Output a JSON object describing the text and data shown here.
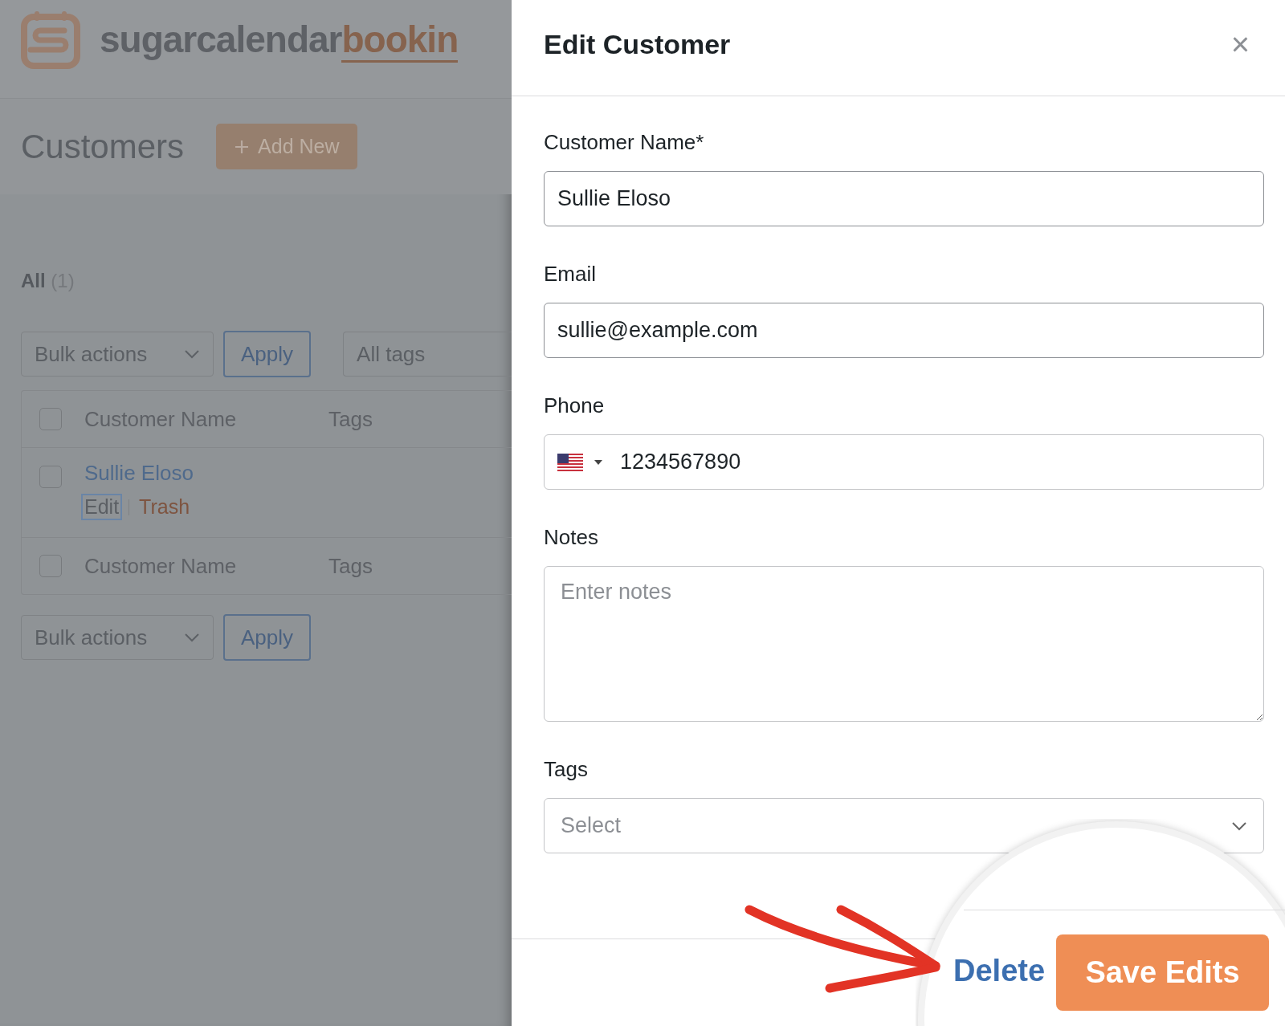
{
  "logo": {
    "main": "sugarcalendar",
    "accent": "bookin"
  },
  "page": {
    "title": "Customers",
    "add_button": "Add New"
  },
  "views": [
    {
      "label": "All",
      "count": "(1)",
      "selected": true
    }
  ],
  "bulk_top": {
    "select": "Bulk actions",
    "apply": "Apply",
    "tag_filter": "All tags"
  },
  "table": {
    "header_checked": false,
    "columns": [
      "Customer Name",
      "Tags"
    ],
    "rows": [
      {
        "name": "Sullie Eloso",
        "checked": false,
        "actions": [
          {
            "label": "Edit",
            "kind": "link",
            "focused": true
          },
          {
            "label": "Trash",
            "kind": "danger",
            "focused": false
          }
        ]
      }
    ],
    "footer_checked": false,
    "footer_columns": [
      "Customer Name",
      "Tags"
    ]
  },
  "bulk_bottom": {
    "select": "Bulk actions",
    "apply": "Apply"
  },
  "drawer": {
    "title": "Edit Customer",
    "close": "×",
    "fields": [
      {
        "kind": "text",
        "label": "Customer Name*",
        "value": "Sullie Eloso"
      },
      {
        "kind": "text",
        "label": "Email",
        "value": "sullie@example.com"
      },
      {
        "kind": "phone",
        "label": "Phone",
        "value": "1234567890"
      },
      {
        "kind": "textarea",
        "label": "Notes",
        "placeholder": "Enter notes"
      },
      {
        "kind": "select",
        "label": "Tags",
        "placeholder": "Select"
      }
    ],
    "delete": "Delete",
    "save": "Save Edits"
  }
}
